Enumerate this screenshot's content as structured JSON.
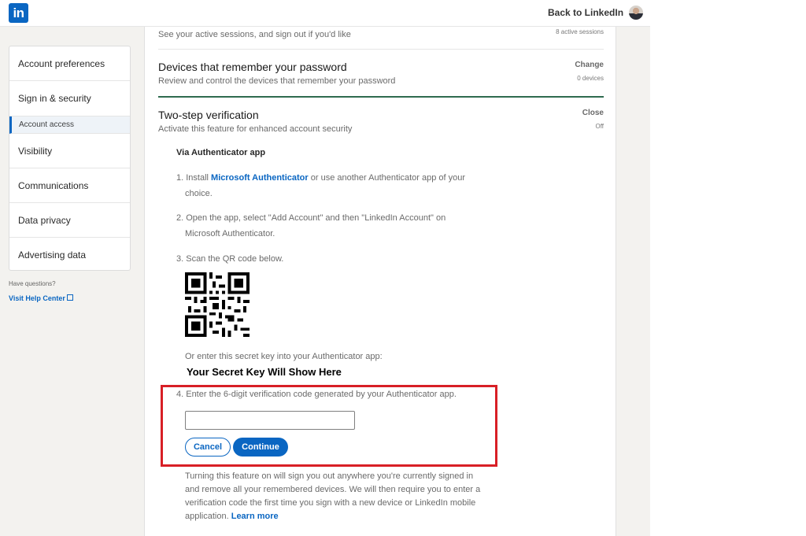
{
  "header": {
    "logo_text": "in",
    "back_link": "Back to LinkedIn"
  },
  "sidebar": {
    "items": [
      {
        "label": "Account preferences"
      },
      {
        "label": "Sign in & security"
      },
      {
        "label": "Visibility"
      },
      {
        "label": "Communications"
      },
      {
        "label": "Data privacy"
      },
      {
        "label": "Advertising data"
      }
    ],
    "sub_item": "Account access",
    "help_question": "Have questions?",
    "help_link": "Visit Help Center"
  },
  "sections": {
    "sessions": {
      "subtitle": "See your active sessions, and sign out if you'd like",
      "meta": "8 active sessions"
    },
    "devices": {
      "title": "Devices that remember your password",
      "subtitle": "Review and control the devices that remember your password",
      "action": "Change",
      "meta": "0 devices"
    },
    "two_step": {
      "title": "Two-step verification",
      "subtitle": "Activate this feature for enhanced account security",
      "action": "Close",
      "meta": "Off"
    }
  },
  "setup": {
    "via": "Via Authenticator app",
    "step1_prefix": "1. Install ",
    "step1_link": "Microsoft Authenticator",
    "step1_suffix": " or use another Authenticator app of your",
    "step1_line2": "choice.",
    "step2_line1": "2. Open the app, select \"Add Account\" and then \"LinkedIn Account\" on",
    "step2_line2": "Microsoft Authenticator.",
    "step3": "3. Scan the QR code below.",
    "secret_prompt": "Or enter this secret key into your Authenticator app:",
    "secret_key": "Your Secret Key Will Show Here",
    "step4": "4. Enter the 6-digit verification code generated by your Authenticator app.",
    "code_value": "",
    "cancel_label": "Cancel",
    "continue_label": "Continue",
    "note_line1": "Turning this feature on will sign you out anywhere you're currently signed in",
    "note_line2": "and remove all your remembered devices. We will then require you to enter a",
    "note_line3": "verification code the first time you sign with a new device or LinkedIn mobile",
    "note_line4_prefix": "application. ",
    "learn_more": "Learn more"
  },
  "colors": {
    "brand": "#0a66c2",
    "highlight_box": "#d81f26",
    "divider_active": "#2f6b4f"
  }
}
